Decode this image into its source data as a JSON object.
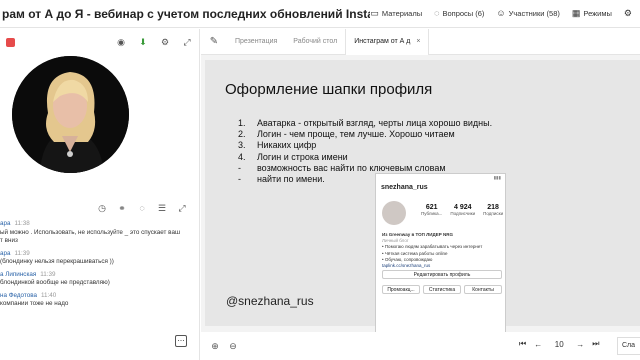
{
  "header": {
    "title": "рам от А до Я - вебинар с учетом последних обновлений Instagram",
    "nav": [
      {
        "label": "Материалы",
        "icon": "folder-icon"
      },
      {
        "label": "Вопросы (6)",
        "icon": "chat-icon"
      },
      {
        "label": "Участники (58)",
        "icon": "users-icon"
      },
      {
        "label": "Режимы",
        "icon": "grid-icon"
      }
    ]
  },
  "tabs": [
    "Презентация",
    "Рабочий стол",
    "Инстаграм от А д"
  ],
  "slide": {
    "title": "Оформление шапки профиля",
    "items": [
      {
        "marker": "1.",
        "text": "Аватарка - открытый взгляд, черты лица хорошо видны."
      },
      {
        "marker": "2.",
        "text": "Логин - чем проще, тем лучше. Хорошо читаем"
      },
      {
        "marker": "3.",
        "text": "Никаких цифр"
      },
      {
        "marker": "4.",
        "text": "Логин и строка имени"
      },
      {
        "marker": "-",
        "text": "возможность вас найти по ключевым словам"
      },
      {
        "marker": "-",
        "text": "найти по имени."
      }
    ],
    "handle": "@snezhana_rus"
  },
  "profile": {
    "username": "snezhana_rus",
    "posts": "621",
    "posts_label": "Публика...",
    "followers": "4 924",
    "followers_label": "Подписчики",
    "following": "218",
    "following_label": "Подписки",
    "bio": [
      "Из Greenway в ТОП ЛИДЕР NRG",
      "Личный блог",
      "• Помогаю людям зарабатывать через интернет",
      "• Чёткая система работы online",
      "• Обучаю, сопровождаю",
      "taplink.cc/snezhana_rus"
    ],
    "edit_button": "Редактировать профиль",
    "buttons": [
      "Промоакц...",
      "Статистика",
      "Контакты"
    ]
  },
  "chat": [
    {
      "name": "ара",
      "time": "11:38",
      "text": "ый можно . Использовать, не используйте _ это спускает ваш",
      "text2": "т вниз"
    },
    {
      "name": "ара",
      "time": "11:39",
      "text": "(блондинку нельзя перекрашиваться ))"
    },
    {
      "name": "а Липинская",
      "time": "11:39",
      "text": "блондинкой вообще не представляю)"
    },
    {
      "name": "на Федотова",
      "time": "11:40",
      "text": "компании тоже не надо"
    }
  ],
  "pager": {
    "current": "10"
  },
  "next_label": "Сла"
}
